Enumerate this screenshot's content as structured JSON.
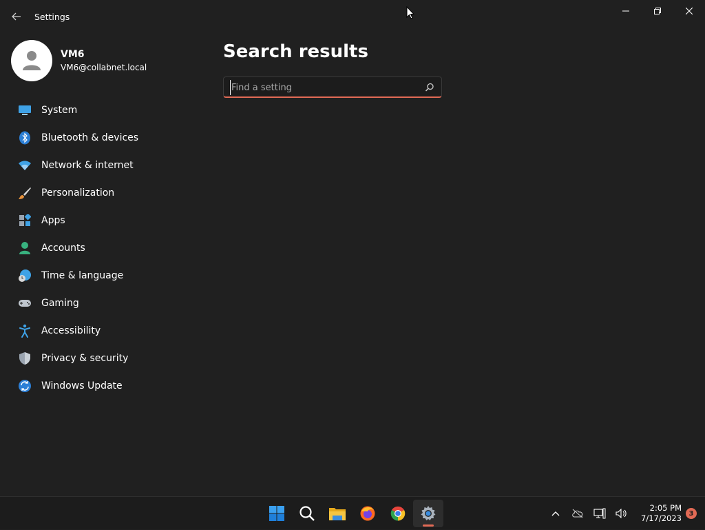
{
  "window": {
    "title": "Settings"
  },
  "profile": {
    "name": "VM6",
    "email": "VM6@collabnet.local"
  },
  "nav": {
    "items": [
      {
        "label": "System",
        "icon": "monitor-icon"
      },
      {
        "label": "Bluetooth & devices",
        "icon": "bluetooth-icon"
      },
      {
        "label": "Network & internet",
        "icon": "wifi-icon"
      },
      {
        "label": "Personalization",
        "icon": "brush-icon"
      },
      {
        "label": "Apps",
        "icon": "apps-icon"
      },
      {
        "label": "Accounts",
        "icon": "account-icon"
      },
      {
        "label": "Time & language",
        "icon": "globe-clock-icon"
      },
      {
        "label": "Gaming",
        "icon": "gamepad-icon"
      },
      {
        "label": "Accessibility",
        "icon": "accessibility-icon"
      },
      {
        "label": "Privacy & security",
        "icon": "shield-icon"
      },
      {
        "label": "Windows Update",
        "icon": "update-icon"
      }
    ]
  },
  "main": {
    "title": "Search results",
    "search": {
      "placeholder": "Find a setting",
      "value": ""
    }
  },
  "taskbar": {
    "apps": [
      "windows-start-icon",
      "search-icon",
      "file-explorer-icon",
      "firefox-icon",
      "chrome-icon",
      "settings-gear-icon"
    ],
    "active_app": "settings-gear-icon"
  },
  "tray": {
    "time": "2:05 PM",
    "date": "7/17/2023",
    "notification_count": "3"
  },
  "colors": {
    "background": "#202020",
    "accent": "#e26a55",
    "taskbar": "#1c1c1c"
  }
}
